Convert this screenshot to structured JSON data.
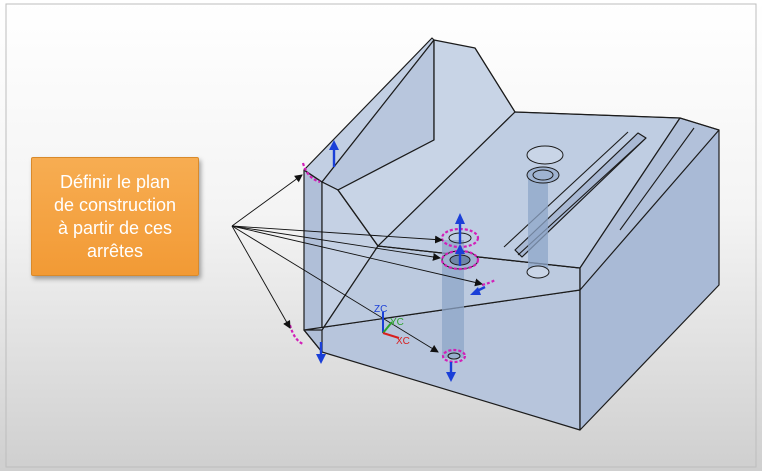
{
  "callout": {
    "lines": [
      "Définir le plan",
      "de construction",
      "à partir de ces",
      "arrêtes"
    ]
  },
  "triad": {
    "z_label": "ZC",
    "y_label": "YC",
    "x_label": "XC"
  },
  "colors": {
    "background_top": "#ffffff",
    "background_bottom": "#cfcfcf",
    "part_face": "#b5c4dc",
    "part_edge": "#1c1c1c",
    "callout": "#f39c3c",
    "edge_highlight": "#d21fb8",
    "normal_vector": "#1a3fd8",
    "axis_x": "#d81f1f",
    "axis_y": "#2ca32c",
    "axis_z": "#1a3fd8"
  }
}
